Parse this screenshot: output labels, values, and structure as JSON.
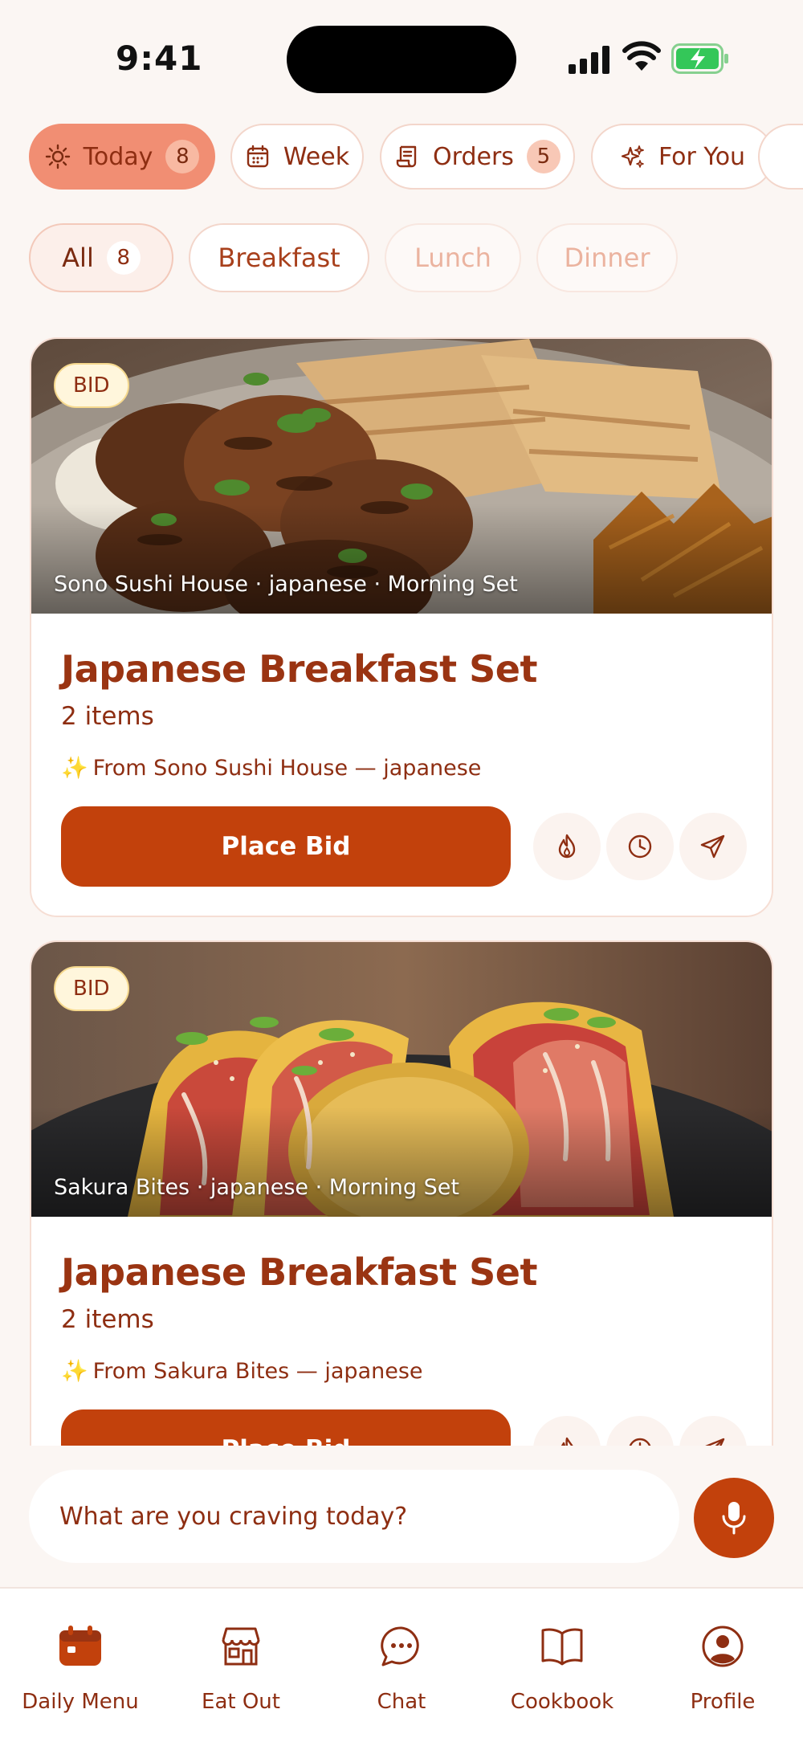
{
  "status_bar": {
    "time": "9:41"
  },
  "view_tabs": [
    {
      "label": "Today",
      "count": "8",
      "icon": "sun-icon",
      "active": true
    },
    {
      "label": "Week",
      "icon": "calendar-icon"
    },
    {
      "label": "Orders",
      "count": "5",
      "icon": "receipt-icon"
    },
    {
      "label": "For You",
      "icon": "sparkles-icon"
    }
  ],
  "meal_filters": [
    {
      "label": "All",
      "count": "8",
      "active": true
    },
    {
      "label": "Breakfast"
    },
    {
      "label": "Lunch"
    },
    {
      "label": "Dinner"
    }
  ],
  "cards": [
    {
      "badge": "BID",
      "caption": "Sono Sushi House · japanese · Morning Set",
      "title": "Japanese Breakfast Set",
      "subtitle": "2 items",
      "sparkle": "✨",
      "from": "From Sono Sushi House — japanese",
      "button": "Place Bid",
      "image": "grilled patties with flatbread and pickled vegetables"
    },
    {
      "badge": "BID",
      "caption": "Sakura Bites · japanese · Morning Set",
      "title": "Japanese Breakfast Set",
      "subtitle": "2 items",
      "sparkle": "✨",
      "from": "From Sakura Bites — japanese",
      "button": "Place Bid",
      "image": "seared tuna tacos with scallions and sesame"
    }
  ],
  "search": {
    "placeholder": "What are you craving today?"
  },
  "nav": [
    {
      "label": "Daily Menu",
      "icon": "calendar-filled-icon",
      "active": true
    },
    {
      "label": "Eat Out",
      "icon": "storefront-icon"
    },
    {
      "label": "Chat",
      "icon": "chat-bubble-icon"
    },
    {
      "label": "Cookbook",
      "icon": "open-book-icon"
    },
    {
      "label": "Profile",
      "icon": "user-circle-icon"
    }
  ],
  "colors": {
    "accent": "#C2410C",
    "active_tab": "#F18E73",
    "text": "#8E2E12",
    "background": "#FBF6F3"
  }
}
